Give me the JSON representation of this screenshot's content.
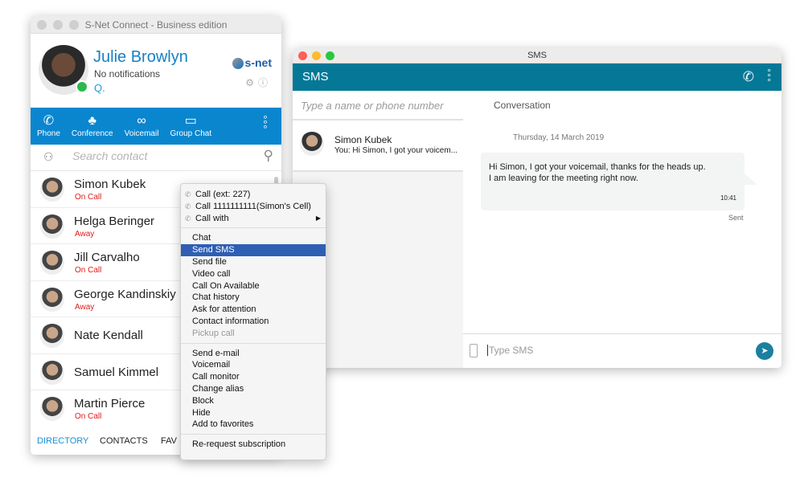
{
  "directory": {
    "window_title": "S-Net Connect - Business edition",
    "profile": {
      "name": "Julie Browlyn",
      "notification": "No notifications",
      "presence": "available",
      "chat_status": "Q.",
      "logo_text": "s-net"
    },
    "toolbar": [
      {
        "label": "Phone",
        "icon": "phone-icon"
      },
      {
        "label": "Conference",
        "icon": "conference-icon"
      },
      {
        "label": "Voicemail",
        "icon": "voicemail-icon"
      },
      {
        "label": "Group Chat",
        "icon": "chat-bubble-icon"
      }
    ],
    "search_placeholder": "Search contact",
    "contacts": [
      {
        "name": "Simon Kubek",
        "status": "On Call"
      },
      {
        "name": "Helga Beringer",
        "status": "Away"
      },
      {
        "name": "Jill Carvalho",
        "status": "On Call"
      },
      {
        "name": "George Kandinskiy",
        "status": "Away"
      },
      {
        "name": "Nate Kendall",
        "status": ""
      },
      {
        "name": "Samuel Kimmel",
        "status": ""
      },
      {
        "name": "Martin Pierce",
        "status": "On Call"
      }
    ],
    "tabs": [
      {
        "label": "DIRECTORY",
        "active": true
      },
      {
        "label": "CONTACTS"
      },
      {
        "label": "FAV"
      }
    ],
    "status_color": "#e21a1a",
    "accent": "#0a86cf"
  },
  "context_menu": {
    "group1": [
      "Call (ext: 227)",
      "Call 1111111111(Simon's Cell)",
      "Call with"
    ],
    "group2": [
      "Chat",
      "Send SMS",
      "Send file",
      "Video call",
      "Call On Available",
      "Chat history",
      "Ask for attention",
      "Contact information",
      "Pickup call"
    ],
    "group3": [
      "Send e-mail",
      "Voicemail",
      "Call monitor",
      "Change alias",
      "Block",
      "Hide",
      "Add to favorites"
    ],
    "group4": [
      "Re-request subscription"
    ],
    "highlighted": "Send SMS",
    "disabled": "Pickup call"
  },
  "sms": {
    "window_title": "SMS",
    "header": "SMS",
    "search_placeholder": "Type a name or phone number",
    "conversation": {
      "name": "Simon Kubek",
      "preview": "You: Hi Simon, I got your voicem..."
    },
    "heading": "Conversation",
    "date": "Thursday, 14 March 2019",
    "message": {
      "line1": "Hi Simon, I got your voicemail, thanks for the heads up.",
      "line2": "I am leaving for the meeting right now.",
      "time": "10:41",
      "status": "Sent"
    },
    "input_placeholder": "Type SMS",
    "accent": "#047896"
  }
}
